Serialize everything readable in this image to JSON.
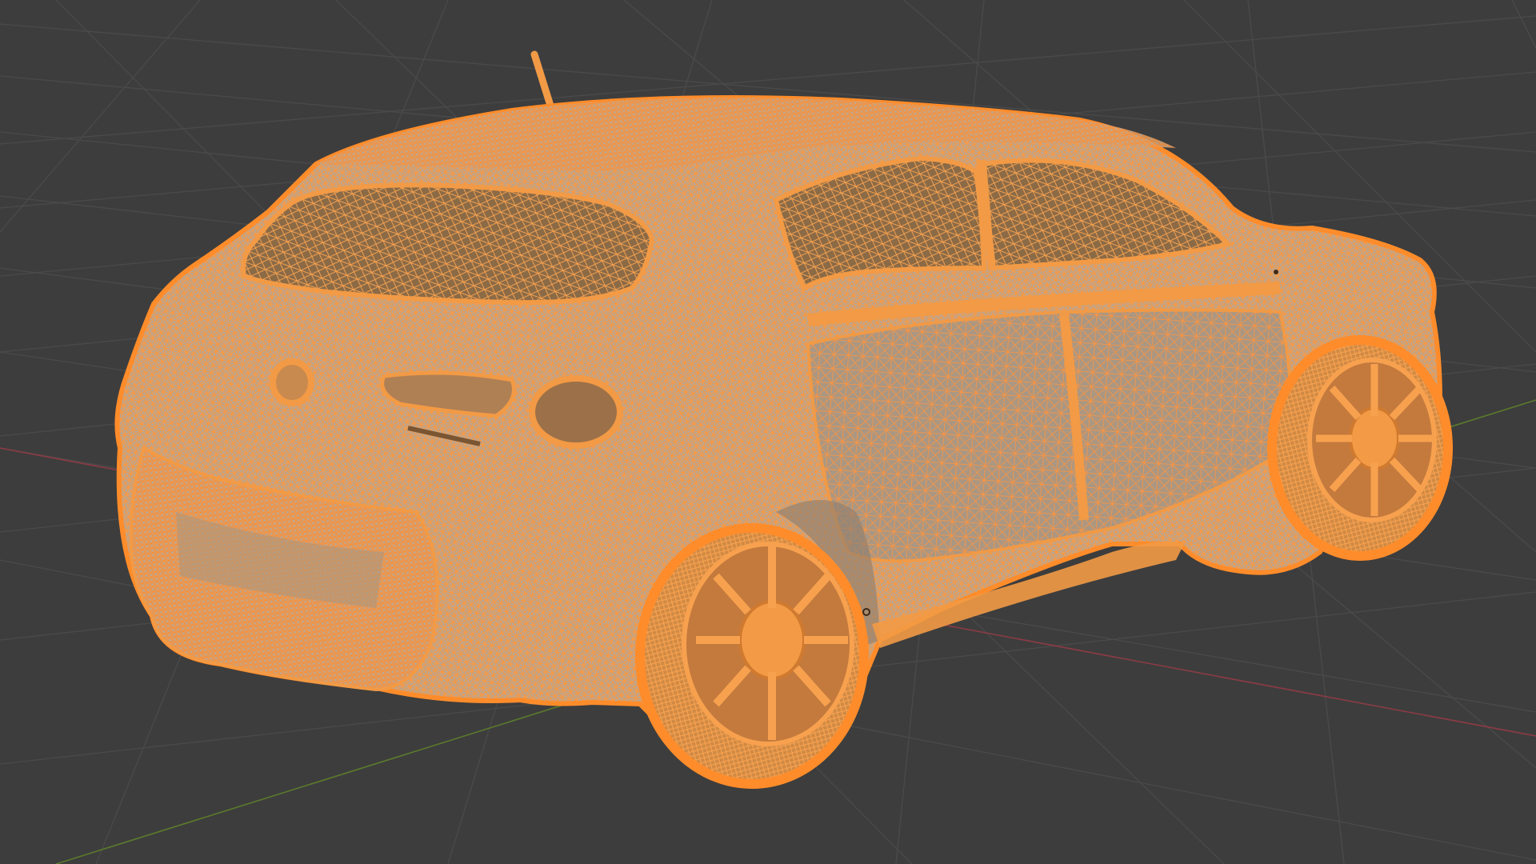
{
  "viewport": {
    "background_color": "#3d3d3d",
    "grid_color": "#4a4a4a",
    "x_axis_color": "#8a3b45",
    "y_axis_color": "#5c7a2c",
    "selection_color": "#f29a45",
    "selection_outline_color": "#ff8c2a",
    "mesh_shade_color": "#b8a89a",
    "object_origin_color": "#3d2a1a"
  },
  "scene": {
    "object": "car-mesh",
    "mode": "edit-mode-wireframe-overlay",
    "selection_state": "all-selected"
  }
}
